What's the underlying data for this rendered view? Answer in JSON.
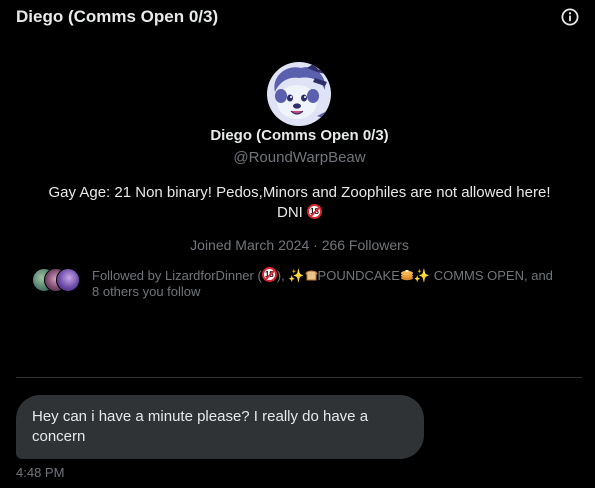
{
  "header": {
    "title": "Diego (Comms Open 0/3)",
    "info_icon": "info-icon"
  },
  "profile": {
    "display_name": "Diego (Comms Open 0/3)",
    "handle": "@RoundWarpBeaw",
    "bio_text": "Gay Age: 21 Non binary! Pedos,Minors and Zoophiles are not allowed here!",
    "bio_dni": "DNI",
    "dni_badge": "18",
    "joined": "Joined March 2024",
    "separator": "·",
    "followers": "266 Followers"
  },
  "followed_by": {
    "prefix": "Followed by LizardforDinner (",
    "badge": "18",
    "middle": "), ",
    "sparkle_1": "✨",
    "bread_icon": "bread-icon",
    "name_2": "POUNDCAKE",
    "pancake_icon": "pancake-icon",
    "sparkle_2": "✨",
    "suffix": " COMMS OPEN, and",
    "line2": "8 others you follow"
  },
  "message": {
    "text": "Hey can i have a minute please? I really do have a concern",
    "time": "4:48 PM"
  },
  "colors": {
    "background": "#000000",
    "primary_text": "#e7e9ea",
    "secondary_text": "#71767b",
    "bubble": "#2f3336",
    "divider": "#2f3336"
  }
}
